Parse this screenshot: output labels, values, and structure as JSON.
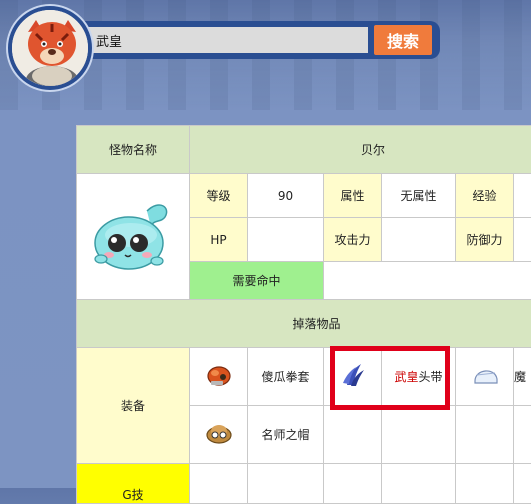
{
  "search": {
    "value": "武皇",
    "button_label": "搜索"
  },
  "monster": {
    "name_label": "怪物名称",
    "name": "贝尔",
    "stats": [
      {
        "label": "等级",
        "value": "90"
      },
      {
        "label": "属性",
        "value": "无属性"
      },
      {
        "label": "经验",
        "value": ""
      },
      {
        "label": "HP",
        "value": ""
      },
      {
        "label": "攻击力",
        "value": ""
      },
      {
        "label": "防御力",
        "value": ""
      }
    ],
    "hit_required": "需要命中"
  },
  "drops": {
    "section_title": "掉落物品",
    "category_equipment": "装备",
    "items": [
      {
        "name": "傻瓜拳套",
        "icon": "glove-icon"
      },
      {
        "name_part1": "武皇",
        "name_part2": "头带",
        "icon": "headband-icon"
      },
      {
        "name": "魔",
        "icon": "cap-icon"
      },
      {
        "name": "名师之帽",
        "icon": "hat-icon"
      }
    ],
    "category_partial": "G技"
  },
  "colors": {
    "header_green": "#d7e6c1",
    "label_yellow": "#fffccc",
    "label_red": "#cc0000",
    "search_orange": "#f07b3c",
    "highlight_red": "#e0001a"
  }
}
